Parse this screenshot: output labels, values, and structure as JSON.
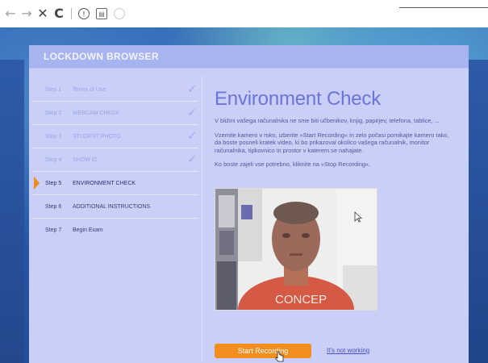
{
  "browser": {
    "back": "←",
    "forward": "→",
    "close": "✕",
    "reload": "C",
    "info": "!",
    "doc": "▤"
  },
  "app": {
    "title": "LOCKDOWN BROWSER"
  },
  "steps": [
    {
      "num": "Step 1",
      "label": "Terms of Use",
      "checked": true
    },
    {
      "num": "Step 2",
      "label": "WEBCAM CHECK",
      "checked": true
    },
    {
      "num": "Step 3",
      "label": "STUDENT PHOTO",
      "checked": true
    },
    {
      "num": "Step 4",
      "label": "SHOW ID",
      "checked": true
    },
    {
      "num": "Step 5",
      "label": "ENVIRONMENT CHECK",
      "current": true
    },
    {
      "num": "Step 6",
      "label": "ADDITIONAL INSTRUCTIONS"
    },
    {
      "num": "Step 7",
      "label": "Begin Exam"
    }
  ],
  "content": {
    "heading": "Environment Check",
    "p1": "V bližini vašega računalnika ne sme biti učbenikov, knjig, papirjev, telefona, tablice, ...",
    "p2": "Vzemite kamero v roko, izberite »Start Recording« in zelo počasi pomikajte kamero tako, da boste posneli kratek video, ki bo prikazoval okolico vašega računalnik, monitor računalnika, tipkovnico in prostor v katerem se nahajate.",
    "p3": "Ko boste zajeli vse potrebno, kliknite na »Stop Recording«.",
    "shirt_text": "CONCEP",
    "record_label": "Start Recording",
    "not_working_label": "It's not working"
  },
  "colors": {
    "accent": "#f28d1e",
    "heading": "#6b74d8",
    "panel": "#cacff7"
  }
}
